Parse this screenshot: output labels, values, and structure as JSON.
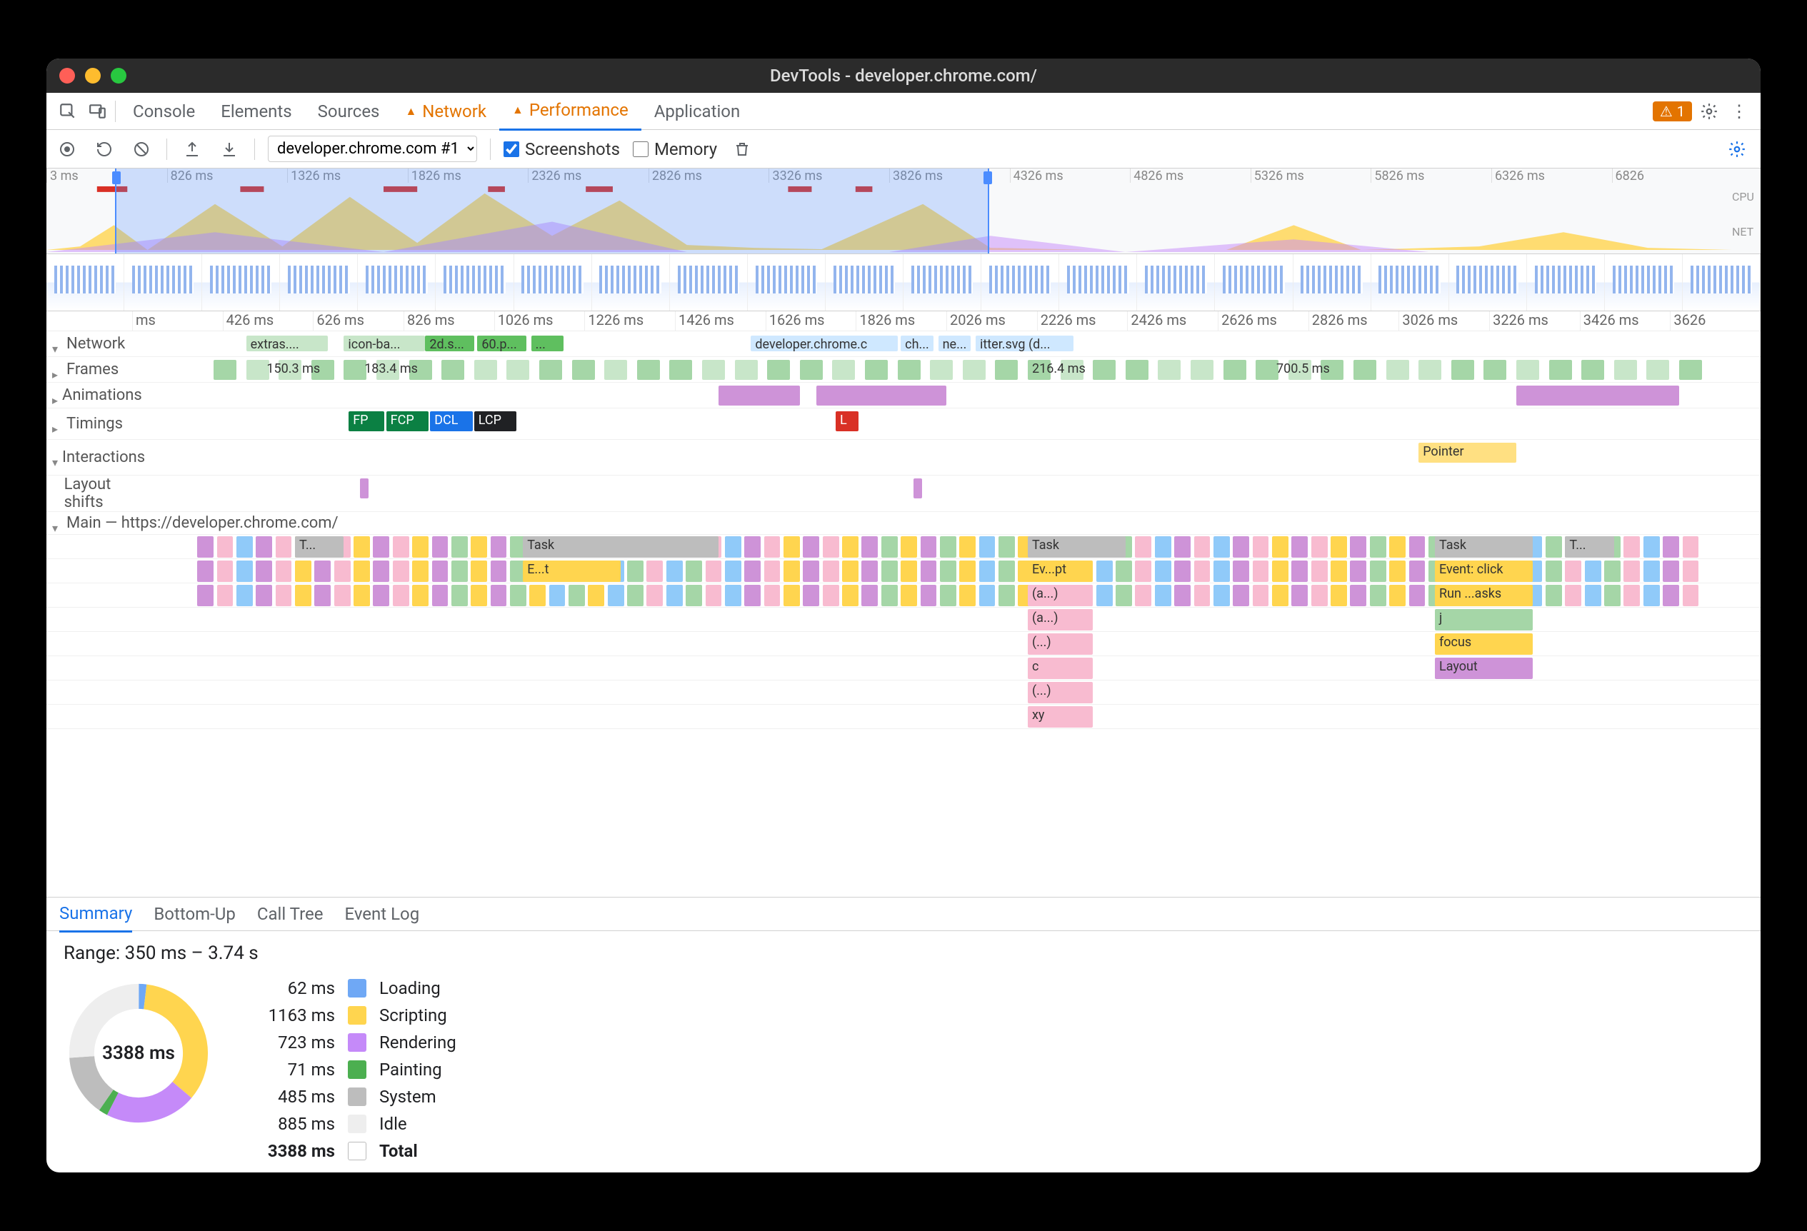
{
  "window": {
    "title": "DevTools - developer.chrome.com/"
  },
  "tabs": {
    "items": [
      "Console",
      "Elements",
      "Sources",
      "Network",
      "Performance",
      "Application"
    ],
    "active": "Performance",
    "warn": [
      "Network",
      "Performance"
    ],
    "issues_count": "1"
  },
  "toolbar": {
    "recording_label": "developer.chrome.com #1",
    "screenshots_label": "Screenshots",
    "screenshots_checked": true,
    "memory_label": "Memory",
    "memory_checked": false
  },
  "overview": {
    "ticks": [
      "3 ms",
      "826 ms",
      "1326 ms",
      "1826 ms",
      "2326 ms",
      "2826 ms",
      "3326 ms",
      "3826 ms",
      "4326 ms",
      "4826 ms",
      "5326 ms",
      "5826 ms",
      "6326 ms",
      "6826"
    ],
    "side": [
      "CPU",
      "NET"
    ],
    "sel_start_pct": 4,
    "sel_end_pct": 55
  },
  "flame": {
    "ruler": [
      "ms",
      "426 ms",
      "626 ms",
      "826 ms",
      "1026 ms",
      "1226 ms",
      "1426 ms",
      "1626 ms",
      "1826 ms",
      "2026 ms",
      "2226 ms",
      "2426 ms",
      "2626 ms",
      "2826 ms",
      "3026 ms",
      "3226 ms",
      "3426 ms",
      "3626"
    ],
    "network_label": "Network",
    "network_items": [
      {
        "l": "extras....",
        "x": 7,
        "w": 5,
        "c": "#c8e6c9"
      },
      {
        "l": "icon-ba...",
        "x": 13,
        "w": 5,
        "c": "#c8e6c9"
      },
      {
        "l": "2d.s...",
        "x": 18,
        "w": 3,
        "c": "#5fbf5f"
      },
      {
        "l": "60.p...",
        "x": 21.2,
        "w": 3,
        "c": "#5fbf5f"
      },
      {
        "l": "...",
        "x": 24.5,
        "w": 2,
        "c": "#5fbf5f"
      },
      {
        "l": "developer.chrome.c",
        "x": 38,
        "w": 9,
        "c": "#cfe8ff"
      },
      {
        "l": "ch...",
        "x": 47.2,
        "w": 2,
        "c": "#cfe8ff"
      },
      {
        "l": "ne...",
        "x": 49.5,
        "w": 2,
        "c": "#cfe8ff"
      },
      {
        "l": "itter.svg (d...",
        "x": 51.8,
        "w": 6,
        "c": "#cfe8ff"
      }
    ],
    "frames_label": "Frames",
    "frames_items": [
      {
        "l": "150.3 ms",
        "x": 8,
        "w": 6,
        "c": "transparent"
      },
      {
        "l": "183.4 ms",
        "x": 14,
        "w": 6,
        "c": "transparent"
      },
      {
        "l": "216.4 ms",
        "x": 55,
        "w": 6,
        "c": "transparent"
      },
      {
        "l": "700.5 ms",
        "x": 70,
        "w": 6,
        "c": "transparent"
      }
    ],
    "animations_label": "Animations",
    "timings_label": "Timings",
    "timings_items": [
      {
        "l": "FP",
        "x": 13.3,
        "w": 2.2,
        "c": "#0b8043",
        "fg": "#fff"
      },
      {
        "l": "FCP",
        "x": 15.6,
        "w": 2.6,
        "c": "#0b8043",
        "fg": "#fff"
      },
      {
        "l": "DCL",
        "x": 18.3,
        "w": 2.6,
        "c": "#1a73e8",
        "fg": "#fff"
      },
      {
        "l": "LCP",
        "x": 21.0,
        "w": 2.6,
        "c": "#202124",
        "fg": "#fff"
      },
      {
        "l": "L",
        "x": 43.2,
        "w": 1.4,
        "c": "#d93025",
        "fg": "#fff"
      }
    ],
    "interactions_label": "Interactions",
    "interactions_items": [
      {
        "l": "Pointer",
        "x": 79,
        "w": 6,
        "c": "#ffe082"
      }
    ],
    "layoutshifts_label": "Layout shifts",
    "main_label": "Main — https://developer.chrome.com/",
    "main_rows": [
      [
        {
          "l": "T...",
          "x": 10,
          "w": 3,
          "c": "#bdbdbd"
        },
        {
          "l": "Task",
          "x": 24,
          "w": 12,
          "c": "#bdbdbd"
        },
        {
          "l": "Task",
          "x": 55,
          "w": 6,
          "c": "#bdbdbd"
        },
        {
          "l": "Task",
          "x": 80,
          "w": 6,
          "c": "#bdbdbd"
        },
        {
          "l": "T...",
          "x": 88,
          "w": 3,
          "c": "#bdbdbd"
        }
      ],
      [
        {
          "l": "E...t",
          "x": 24,
          "w": 6,
          "c": "#ffd54f"
        },
        {
          "l": "Ev...pt",
          "x": 55,
          "w": 4,
          "c": "#ffd54f"
        },
        {
          "l": "Event: click",
          "x": 80,
          "w": 6,
          "c": "#ffd54f"
        }
      ],
      [
        {
          "l": "(a...)",
          "x": 55,
          "w": 4,
          "c": "#f8bbd0"
        },
        {
          "l": "Run ...asks",
          "x": 80,
          "w": 6,
          "c": "#ffd54f"
        }
      ],
      [
        {
          "l": "(a...)",
          "x": 55,
          "w": 4,
          "c": "#f8bbd0"
        },
        {
          "l": "j",
          "x": 80,
          "w": 6,
          "c": "#a5d6a7"
        }
      ],
      [
        {
          "l": "(...)",
          "x": 55,
          "w": 4,
          "c": "#f8bbd0"
        },
        {
          "l": "focus",
          "x": 80,
          "w": 6,
          "c": "#ffd54f"
        }
      ],
      [
        {
          "l": "c",
          "x": 55,
          "w": 4,
          "c": "#f8bbd0"
        },
        {
          "l": "Layout",
          "x": 80,
          "w": 6,
          "c": "#ce93d8"
        }
      ],
      [
        {
          "l": "(...)",
          "x": 55,
          "w": 4,
          "c": "#f8bbd0"
        }
      ],
      [
        {
          "l": "xy",
          "x": 55,
          "w": 4,
          "c": "#f8bbd0"
        }
      ]
    ]
  },
  "tabs2": {
    "items": [
      "Summary",
      "Bottom-Up",
      "Call Tree",
      "Event Log"
    ],
    "active": "Summary"
  },
  "summary": {
    "range": "Range: 350 ms – 3.74 s",
    "total_label": "Total",
    "total_value": "3388 ms",
    "center": "3388 ms",
    "legend": [
      {
        "val": "62 ms",
        "label": "Loading",
        "color": "#6fa8f5"
      },
      {
        "val": "1163 ms",
        "label": "Scripting",
        "color": "#ffd54f"
      },
      {
        "val": "723 ms",
        "label": "Rendering",
        "color": "#c58af9"
      },
      {
        "val": "71 ms",
        "label": "Painting",
        "color": "#4caf50"
      },
      {
        "val": "485 ms",
        "label": "System",
        "color": "#bdbdbd"
      },
      {
        "val": "885 ms",
        "label": "Idle",
        "color": "#eeeeee"
      }
    ]
  },
  "chart_data": {
    "type": "pie",
    "title": "Time breakdown",
    "series": [
      {
        "name": "Loading",
        "value": 62
      },
      {
        "name": "Scripting",
        "value": 1163
      },
      {
        "name": "Rendering",
        "value": 723
      },
      {
        "name": "Painting",
        "value": 71
      },
      {
        "name": "System",
        "value": 485
      },
      {
        "name": "Idle",
        "value": 885
      }
    ],
    "total": 3388,
    "colors": {
      "Loading": "#6fa8f5",
      "Scripting": "#ffd54f",
      "Rendering": "#c58af9",
      "Painting": "#4caf50",
      "System": "#bdbdbd",
      "Idle": "#eeeeee"
    }
  }
}
